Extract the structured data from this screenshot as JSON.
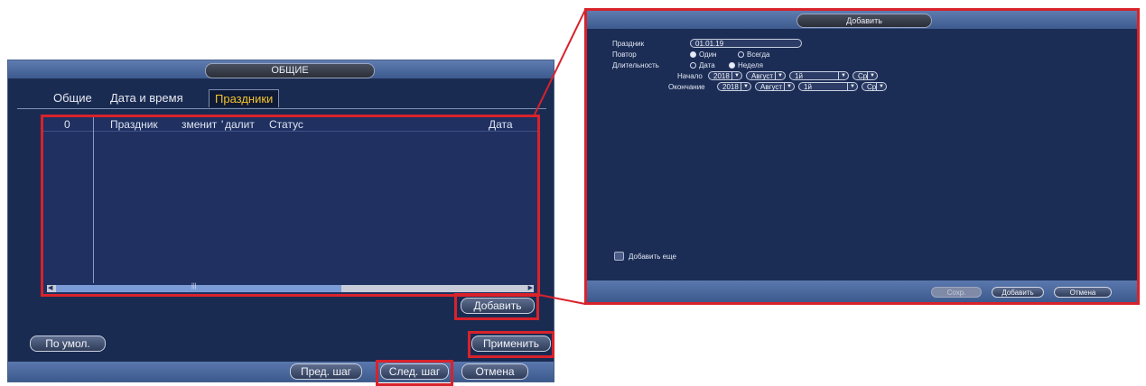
{
  "left": {
    "title": "ОБЩИЕ",
    "tabs": [
      "Общие",
      "Дата и время",
      "Праздники"
    ],
    "table": {
      "columns": [
        "0",
        "Праздник",
        "зменит",
        "далит",
        "Статус",
        "Дата"
      ]
    },
    "scroll_mid": "|||",
    "buttons": {
      "add": "Добавить",
      "default": "По умол.",
      "apply": "Применить",
      "prev": "Пред. шаг",
      "next": "След. шаг",
      "cancel": "Отмена"
    }
  },
  "right": {
    "title": "Добавить",
    "holiday_label": "Праздник",
    "holiday_value": "01.01.19",
    "repeat_label": "Повтор",
    "repeat_once": "Один",
    "repeat_always": "Всегда",
    "duration_label": "Длительность",
    "duration_date": "Дата",
    "duration_week": "Неделя",
    "start_label": "Начало",
    "end_label": "Окончание",
    "start": {
      "year": "2018",
      "month": "Август",
      "week": "1й",
      "day": "Ср"
    },
    "end": {
      "year": "2018",
      "month": "Август",
      "week": "1й",
      "day": "Ср"
    },
    "add_more": "Добавить еще",
    "buttons": {
      "save": "Сохр.",
      "add": "Добавить",
      "cancel": "Отмена"
    }
  }
}
